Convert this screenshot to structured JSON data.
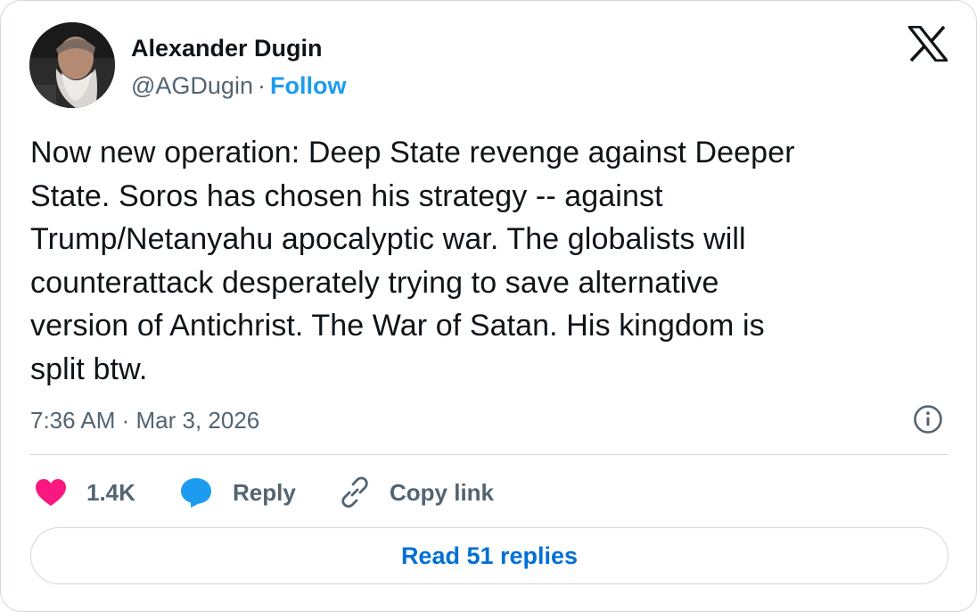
{
  "author": {
    "display_name": "Alexander Dugin",
    "handle": "@AGDugin",
    "separator": "·",
    "follow_label": "Follow"
  },
  "tweet": {
    "lines": [
      "Now new operation: Deep State revenge against Deeper",
      "State. Soros has chosen his strategy -- against",
      "Trump/Netanyahu apocalyptic war. The globalists will",
      "counterattack desperately trying to save alternative",
      "version of Antichrist. The War of Satan. His kingdom is",
      "split btw."
    ],
    "timestamp": "7:36 AM · Mar 3, 2026"
  },
  "actions": {
    "like_count": "1.4K",
    "reply_label": "Reply",
    "copy_link_label": "Copy link"
  },
  "read_replies_label": "Read 51 replies",
  "icons": {
    "brand": "x-logo-icon",
    "info": "info-icon",
    "like": "heart-icon",
    "reply": "speech-bubble-icon",
    "copy": "link-icon"
  },
  "colors": {
    "text": "#0f1419",
    "secondary": "#536471",
    "follow": "#1d9bf0",
    "read_replies": "#006fd6",
    "heart": "#f91880",
    "reply_bubble": "#1d9bf0",
    "border": "#cfd9de"
  }
}
